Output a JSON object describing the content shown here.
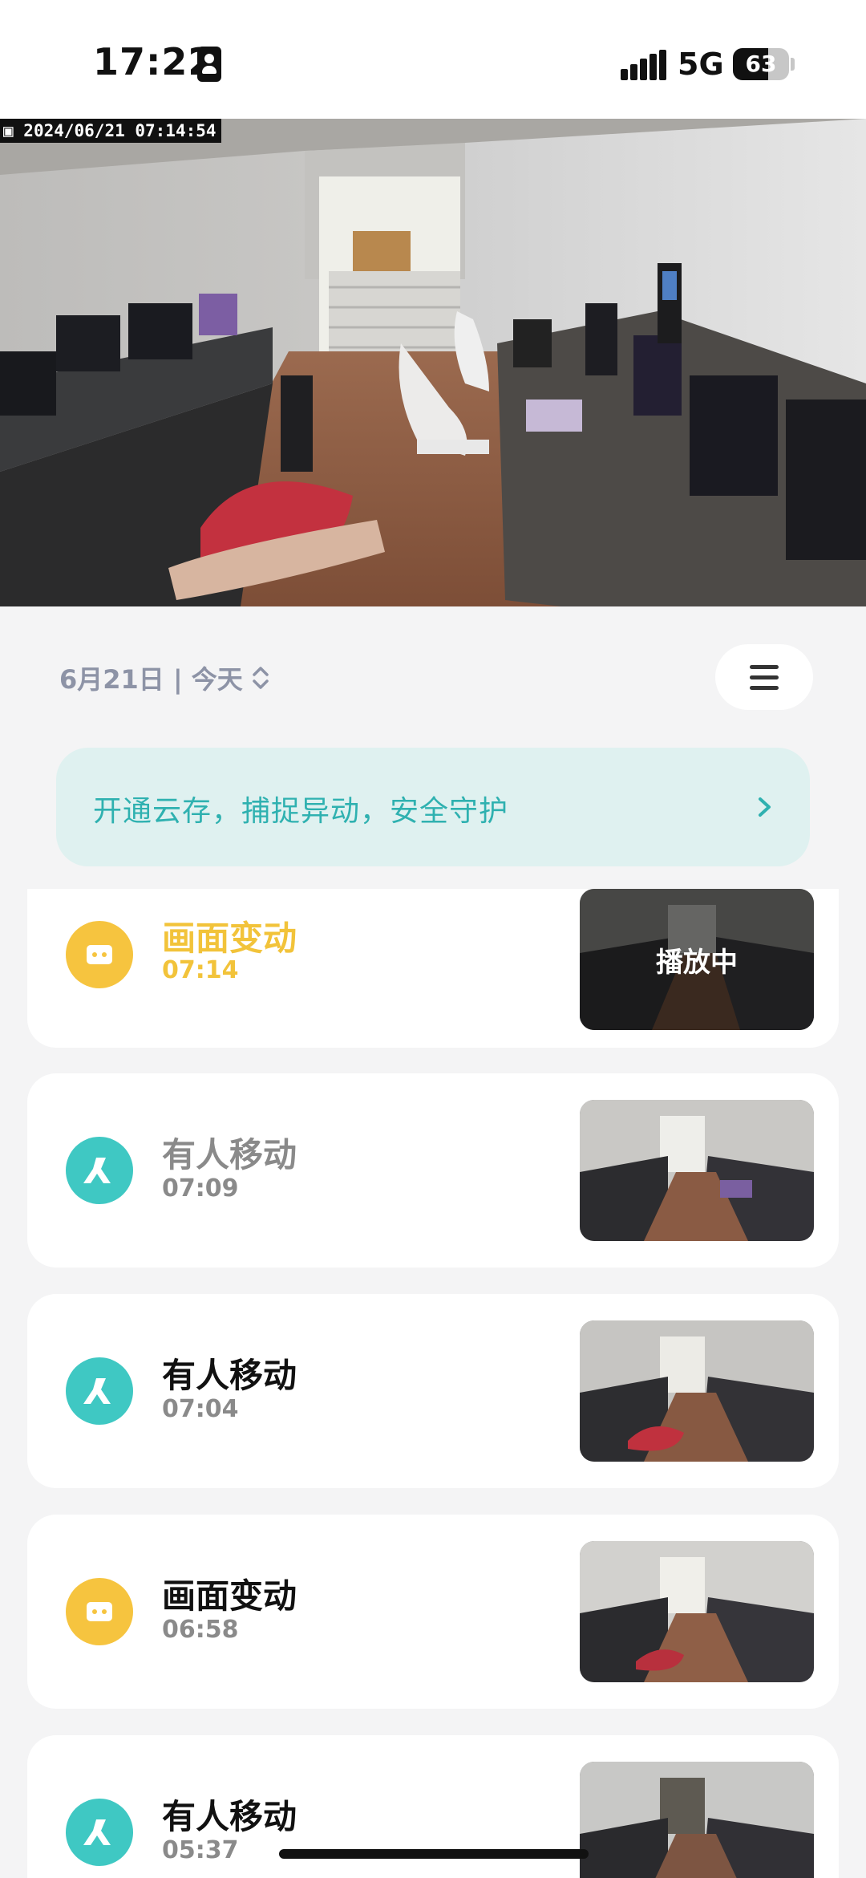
{
  "status_bar": {
    "time": "17:22",
    "network": "5G",
    "battery": "63",
    "battery_level_percent": 63,
    "icons": [
      "contact-card-icon",
      "signal-bars-icon",
      "battery-icon"
    ]
  },
  "camera_feed": {
    "timestamp": "2024/06/21 07:14:54",
    "icon": "camera-icon"
  },
  "date_selector": {
    "label": "6月21日 | 今天",
    "icon": "expand-updown-icon"
  },
  "menu_button": {
    "icon": "menu-icon"
  },
  "cloud_banner": {
    "text": "开通云存，捕捉异动，安全守护",
    "icon": "chevron-right-icon"
  },
  "events": [
    {
      "title": "画面变动",
      "time": "07:14",
      "type": "motion",
      "icon": "motion-frame-icon",
      "thumb_label": "播放中",
      "state": "playing"
    },
    {
      "title": "有人移动",
      "time": "07:09",
      "type": "person",
      "icon": "person-walk-icon",
      "thumb_label": "",
      "state": "viewed"
    },
    {
      "title": "有人移动",
      "time": "07:04",
      "type": "person",
      "icon": "person-walk-icon",
      "thumb_label": "",
      "state": "normal"
    },
    {
      "title": "画面变动",
      "time": "06:58",
      "type": "motion",
      "icon": "motion-frame-icon",
      "thumb_label": "",
      "state": "normal"
    },
    {
      "title": "有人移动",
      "time": "05:37",
      "type": "person",
      "icon": "person-walk-icon",
      "thumb_label": "",
      "state": "normal"
    }
  ],
  "colors": {
    "motion": "#f6c43f",
    "person": "#3fc8c3",
    "banner_bg": "#dff1f0",
    "banner_text": "#2fb1b0",
    "active_text": "#f2c33a"
  }
}
